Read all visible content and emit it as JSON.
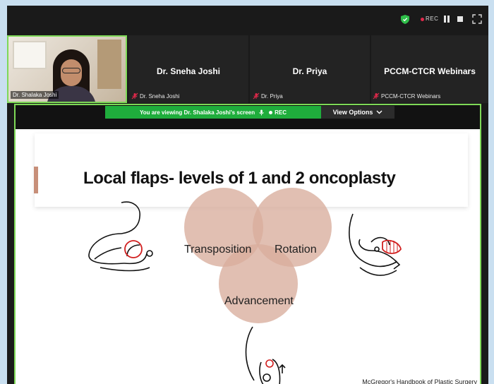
{
  "topbar": {
    "rec_label": "REC",
    "icons": [
      "shield-icon",
      "pause-icon",
      "stop-icon",
      "grid-icon"
    ]
  },
  "participants": [
    {
      "video_label": "Dr. Shalaka Joshi",
      "active": true
    },
    {
      "display_name": "Dr. Sneha Joshi",
      "tag": "Dr. Sneha Joshi"
    },
    {
      "display_name": "Dr. Priya",
      "tag": "Dr. Priya"
    },
    {
      "display_name": "PCCM-CTCR Webinars",
      "tag": "PCCM-CTCR Webinars"
    }
  ],
  "share_bar": {
    "banner_text": "You are viewing  Dr. Shalaka Joshi's screen",
    "banner_rec": "REC",
    "view_options_label": "View Options"
  },
  "slide": {
    "title": "Local flaps- levels of 1 and 2 oncoplasty",
    "circles": [
      "Transposition",
      "Rotation",
      "Advancement"
    ],
    "citation": "McGregor's Handbook of Plastic Surgery"
  },
  "colors": {
    "accent_green": "#7ed957",
    "banner_green": "#1fad3c",
    "circle_fill": "#d8ad9c",
    "mute_red": "#e0284a",
    "accent_bar": "#c78f79"
  }
}
